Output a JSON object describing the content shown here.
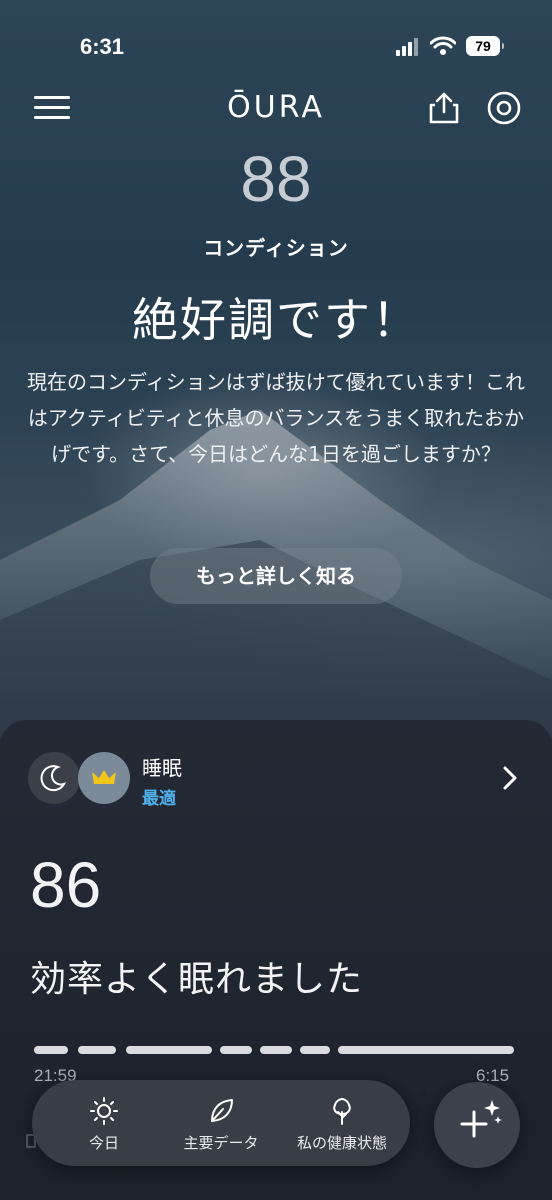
{
  "status_bar": {
    "time": "6:31",
    "battery": "79"
  },
  "header": {
    "logo": "ŌURA"
  },
  "readiness": {
    "score": "88",
    "label": "コンディション",
    "headline": "絶好調です！",
    "description": "現在のコンディションはずば抜けて優れています！これはアクティビティと休息のバランスをうまく取れたおかげです。さて、今日はどんな1日を過ごしますか？",
    "more_button": "もっと詳しく知る"
  },
  "sleep_card": {
    "title": "睡眠",
    "status": "最適",
    "score": "86",
    "message": "効率よく眠れました",
    "start_time": "21:59",
    "end_time": "6:15"
  },
  "tabbar": {
    "tabs": [
      {
        "label": "今日",
        "icon": "sun-icon"
      },
      {
        "label": "主要データ",
        "icon": "leaf-icon"
      },
      {
        "label": "私の健康状態",
        "icon": "tree-icon"
      }
    ],
    "fab_icon": "plus-sparkle-icon"
  },
  "colors": {
    "accent_blue": "#4fb0ea",
    "card_bg": "#242a35",
    "score_gray": "#c6ccd2"
  }
}
